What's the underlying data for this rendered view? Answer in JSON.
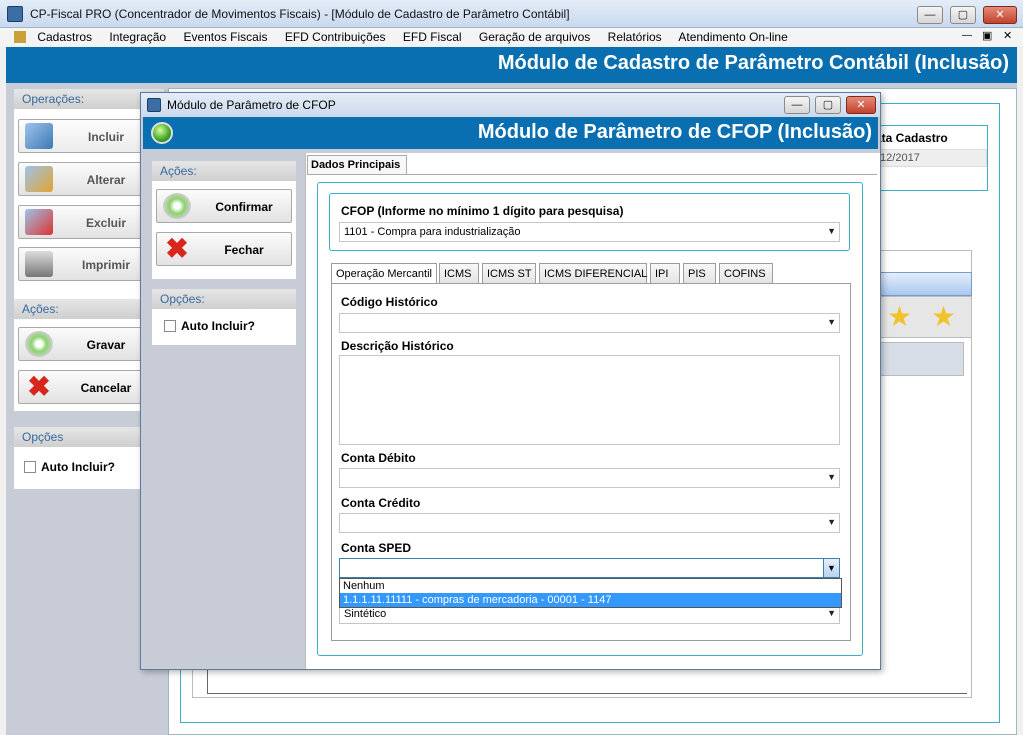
{
  "main_window": {
    "title": "CP-Fiscal PRO (Concentrador de Movimentos Fiscais) - [Módulo de Cadastro de Parâmetro Contábil]",
    "menu": [
      "Cadastros",
      "Integração",
      "Eventos Fiscais",
      "EFD Contribuições",
      "EFD Fiscal",
      "Geração de arquivos",
      "Relatórios",
      "Atendimento On-line"
    ],
    "banner": "Módulo de Cadastro de Parâmetro Contábil (Inclusão)",
    "operacoes_header": "Operações:",
    "op_buttons": {
      "incluir": "Incluir",
      "alterar": "Alterar",
      "excluir": "Excluir",
      "imprimir": "Imprimir"
    },
    "acoes_header": "Ações:",
    "gravar": "Gravar",
    "cancelar": "Cancelar",
    "opcoes_header": "Opções",
    "auto_incluir": "Auto Incluir?",
    "data_cadastro_label": "ata Cadastro",
    "data_cadastro_value": "/12/2017"
  },
  "dialog": {
    "title": "Módulo de Parâmetro de CFOP",
    "banner": "Módulo de Parâmetro de CFOP (Inclusão)",
    "acoes_header": "Ações:",
    "confirmar": "Confirmar",
    "fechar": "Fechar",
    "opcoes_header": "Opções:",
    "auto_incluir": "Auto Incluir?",
    "tab_main": "Dados Principais",
    "cfop_label": "CFOP (Informe no mínimo 1 dígito para pesquisa)",
    "cfop_value": "1101 - Compra para industrialização",
    "sub_tabs": [
      "Operação Mercantil",
      "ICMS",
      "ICMS ST",
      "ICMS DIFERENCIAL",
      "IPI",
      "PIS",
      "COFINS"
    ],
    "codigo_historico_label": "Código Histórico",
    "descricao_historico_label": "Descrição Histórico",
    "conta_debito_label": "Conta Débito",
    "conta_credito_label": "Conta Crédito",
    "conta_sped_label": "Conta SPED",
    "dropdown_options": [
      "Nenhum",
      "1.1.1.11.11111 - compras de mercadoria - 00001 - 1147"
    ],
    "tipo_value": "Sintético"
  },
  "colors": {
    "accent": "#0a6fb0",
    "title_bar": "#d6e3f3",
    "selection": "#3399ff"
  }
}
